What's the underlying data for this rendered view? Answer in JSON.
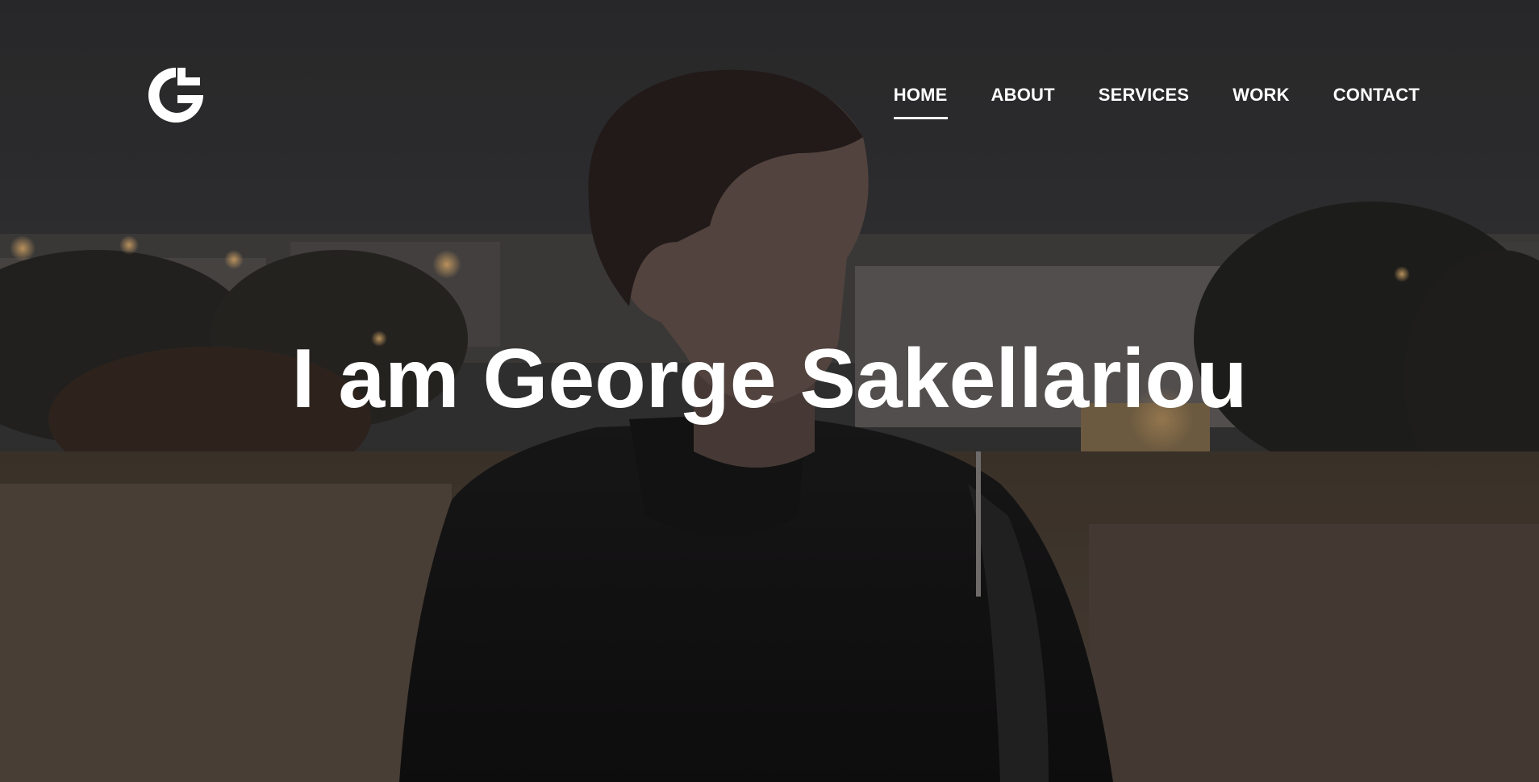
{
  "site": {
    "logo_icon": "gs-monogram-icon"
  },
  "nav": {
    "items": [
      {
        "label": "HOME",
        "active": true
      },
      {
        "label": "ABOUT",
        "active": false
      },
      {
        "label": "SERVICES",
        "active": false
      },
      {
        "label": "WORK",
        "active": false
      },
      {
        "label": "CONTACT",
        "active": false
      }
    ]
  },
  "hero": {
    "headline": "I am George Sakellariou",
    "background_image": "portrait-photo",
    "colors": {
      "text": "#ffffff",
      "sky": "#333335",
      "overlay": "rgba(0,0,0,0.22)"
    }
  }
}
